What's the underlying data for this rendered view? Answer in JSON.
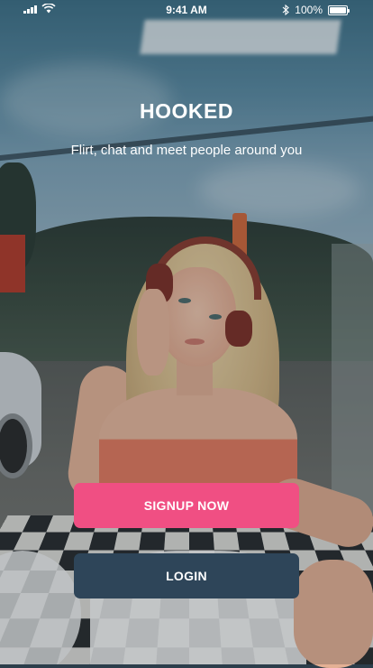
{
  "status_bar": {
    "time": "9:41 AM",
    "battery": "100%",
    "icons": [
      "signal-icon",
      "wifi-icon",
      "bluetooth-icon",
      "battery-icon"
    ]
  },
  "brand": {
    "title": "HOOKED",
    "tagline": "Flirt, chat and meet people around you"
  },
  "actions": {
    "signup_label": "SIGNUP NOW",
    "login_label": "LOGIN"
  },
  "colors": {
    "signup_button": "#f04f83",
    "login_button": "#2e4559",
    "text": "#ffffff"
  }
}
